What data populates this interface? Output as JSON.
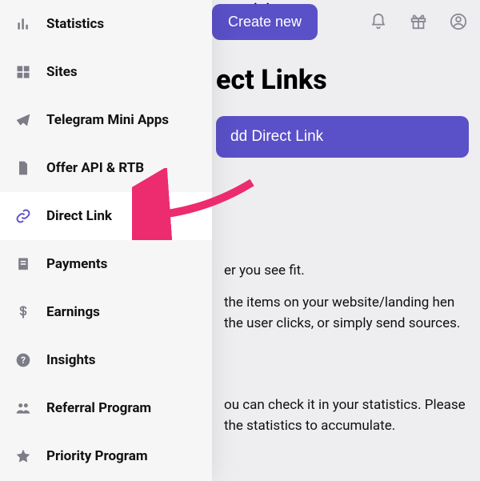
{
  "header": {
    "create_label": "Create new"
  },
  "page": {
    "title_visible": "ect Links",
    "add_button_visible": "dd Direct Link"
  },
  "body": {
    "line1": "er you see fit.",
    "line2": "the items on your website/landing hen the user clicks, or simply send sources.",
    "line3": "ou can check it in your statistics. Please the statistics to accumulate."
  },
  "sidebar": {
    "items": [
      {
        "label": "Statistics",
        "icon": "bars-icon"
      },
      {
        "label": "Sites",
        "icon": "grid-icon"
      },
      {
        "label": "Telegram Mini Apps",
        "icon": "send-icon"
      },
      {
        "label": "Offer API & RTB",
        "icon": "file-icon"
      },
      {
        "label": "Direct Link",
        "icon": "link-icon",
        "active": true
      },
      {
        "label": "Payments",
        "icon": "receipt-icon"
      },
      {
        "label": "Earnings",
        "icon": "dollar-icon"
      },
      {
        "label": "Insights",
        "icon": "help-icon"
      },
      {
        "label": "Referral Program",
        "icon": "people-icon"
      },
      {
        "label": "Priority Program",
        "icon": "star-icon"
      }
    ]
  },
  "annotation": {
    "arrow_color": "#ed2b6f"
  }
}
